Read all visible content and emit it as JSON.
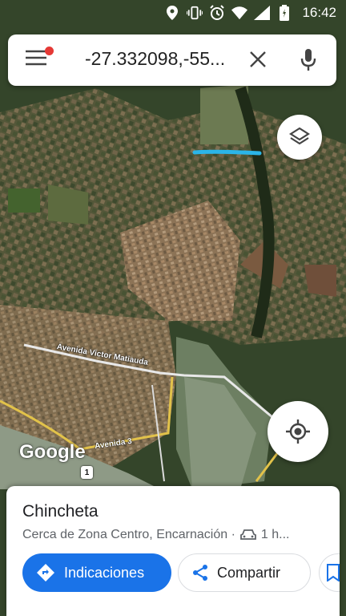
{
  "status_bar": {
    "time": "16:42",
    "icons": [
      "location-icon",
      "vibrate-icon",
      "alarm-icon",
      "wifi-icon",
      "signal-icon",
      "battery-icon"
    ]
  },
  "search": {
    "value": "-27.332098,-55...",
    "menu_has_notification": true
  },
  "map": {
    "logo": "Google",
    "roads": {
      "avenida_victor": "Avenida Victor Matiauda",
      "avenida_3": "Avenida 3",
      "route_number": "1"
    }
  },
  "place_card": {
    "title": "Chincheta",
    "subtitle": "Cerca de Zona Centro, Encarnación ·",
    "travel_time": "1 h...",
    "directions_label": "Indicaciones",
    "share_label": "Compartir"
  },
  "colors": {
    "accent": "#1a73e8",
    "notification_dot": "#e53935",
    "marker_line": "#2bb5e8"
  }
}
